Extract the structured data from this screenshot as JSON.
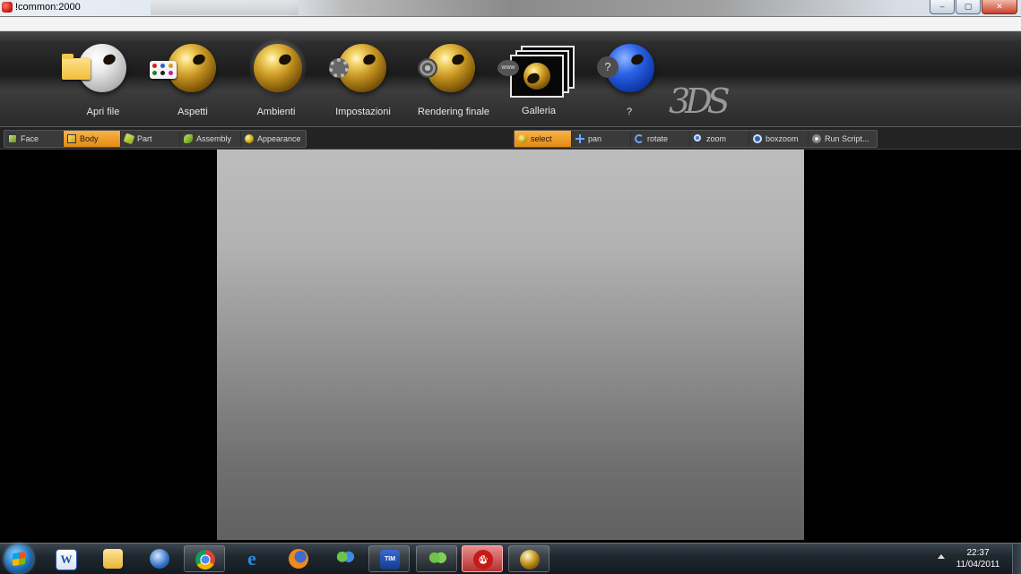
{
  "window": {
    "title": "!common:2000"
  },
  "window_buttons": {
    "minimize": "–",
    "maximize": "▢",
    "close": "✕"
  },
  "main_toolbar": {
    "tools": [
      {
        "label": "Apri file",
        "icon": "folder-sphere-icon"
      },
      {
        "label": "Aspetti",
        "icon": "appearance-sphere-icon"
      },
      {
        "label": "Ambienti",
        "icon": "environment-sphere-icon"
      },
      {
        "label": "Impostazioni",
        "icon": "settings-sphere-icon"
      },
      {
        "label": "Rendering finale",
        "icon": "render-sphere-icon"
      },
      {
        "label": "Galleria",
        "icon": "gallery-icon"
      },
      {
        "label": "?",
        "icon": "help-sphere-icon"
      }
    ],
    "brand_logo": "3DS"
  },
  "selection_filters": [
    {
      "label": "Face",
      "icon": "face-cube-icon",
      "active": false
    },
    {
      "label": "Body",
      "icon": "body-cube-icon",
      "active": true
    },
    {
      "label": "Part",
      "icon": "part-icon",
      "active": false
    },
    {
      "label": "Assembly",
      "icon": "assembly-icon",
      "active": false
    },
    {
      "label": "Appearance",
      "icon": "appearance-ball-icon",
      "active": false
    }
  ],
  "view_tools": [
    {
      "label": "select",
      "icon": "select-icon",
      "active": true
    },
    {
      "label": "pan",
      "icon": "pan-icon",
      "active": false
    },
    {
      "label": "rotate",
      "icon": "rotate-icon",
      "active": false
    },
    {
      "label": "zoom",
      "icon": "zoom-icon",
      "active": false
    },
    {
      "label": "boxzoom",
      "icon": "boxzoom-icon",
      "active": false
    },
    {
      "label": "Run Script...",
      "icon": "script-icon",
      "active": false
    }
  ],
  "taskbar": {
    "items": [
      "windows-start-icon",
      "word-icon",
      "explorer-icon",
      "thunderbird-icon",
      "chrome-icon",
      "internet-explorer-icon",
      "firefox-icon",
      "messenger-icon",
      "tim-icon",
      "live-messenger-icon",
      "solidworks-icon",
      "photoview-icon"
    ],
    "clock_time": "22:37",
    "clock_date": "11/04/2011"
  },
  "colors": {
    "active_button": "#f0a030",
    "viewport_top": "#bdbdbd",
    "viewport_bottom": "#616161"
  }
}
